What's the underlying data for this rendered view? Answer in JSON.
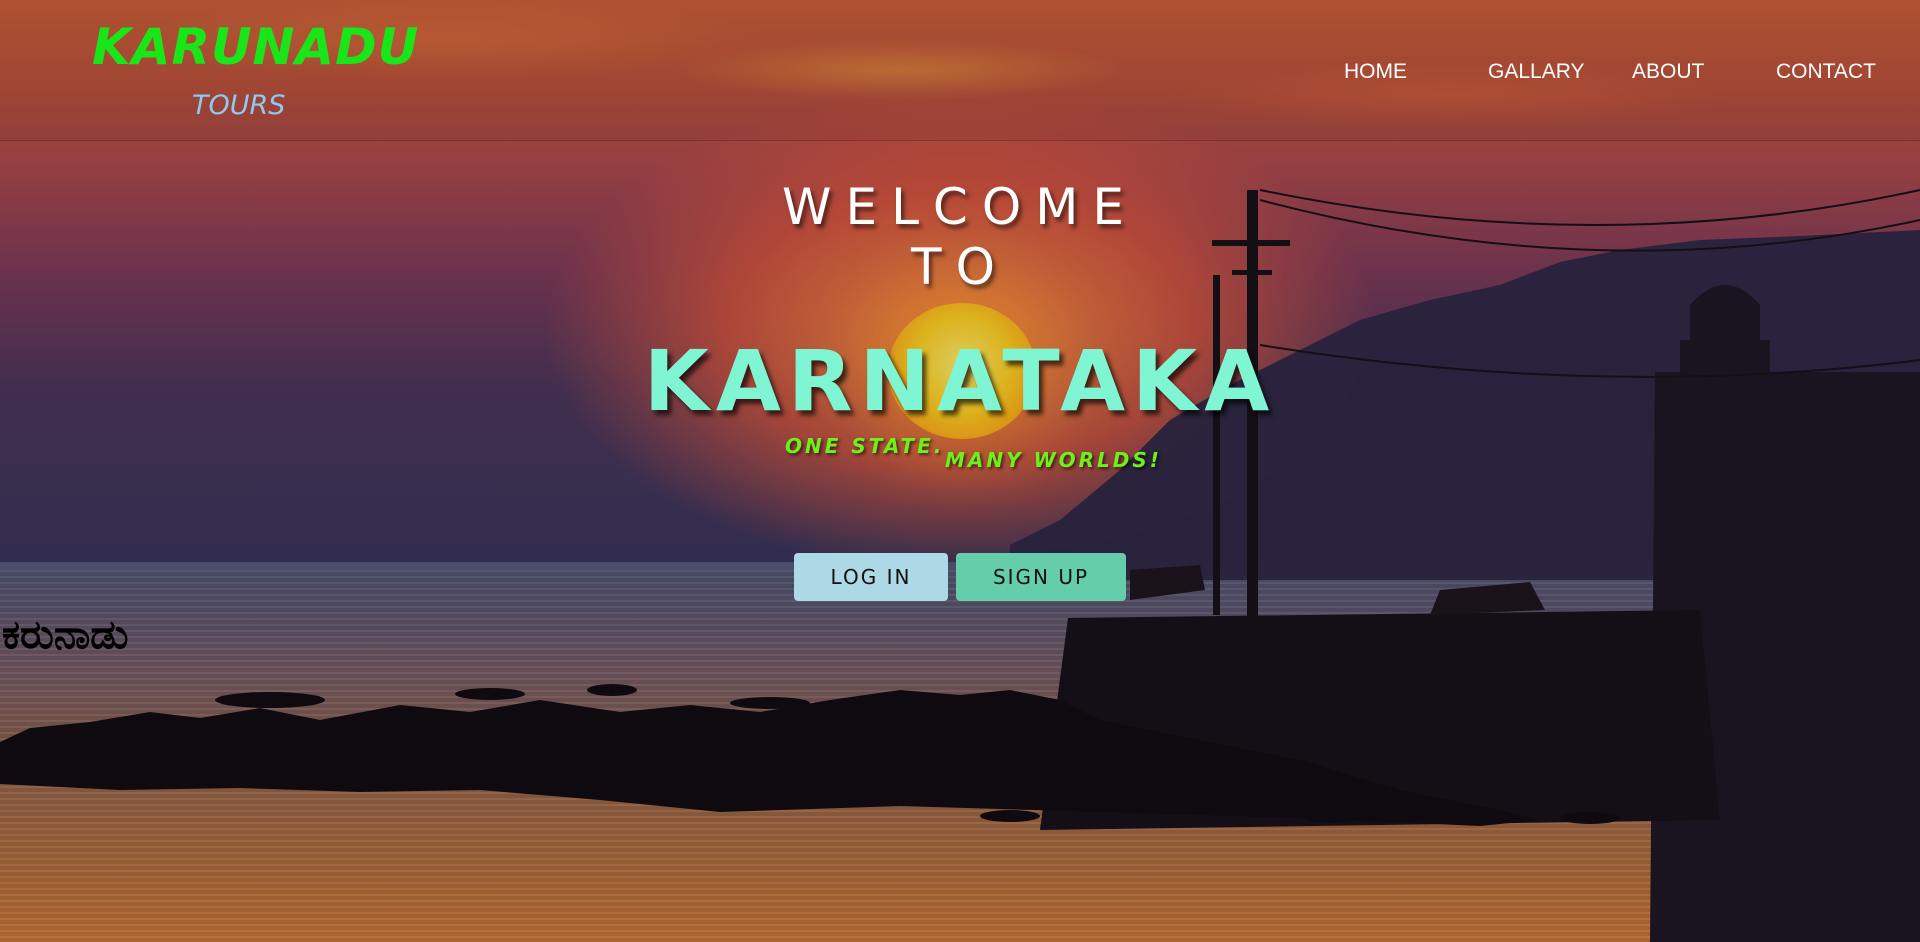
{
  "brand": {
    "title": "KARUNADU",
    "subtitle": "TOURS",
    "title_color": "#19e619",
    "subtitle_color": "#8fc8f0"
  },
  "nav": {
    "items": [
      {
        "label": "HOME"
      },
      {
        "label": "GALLARY"
      },
      {
        "label": "ABOUT"
      },
      {
        "label": "CONTACT"
      }
    ]
  },
  "hero": {
    "welcome_line1": "WELCOME",
    "welcome_line2": "TO",
    "headline": "KARNATAKA",
    "headline_color": "#7ff5d4",
    "tagline_part1": "ONE STATE.",
    "tagline_part2": "MANY WORLDS!",
    "tagline_color": "#6ef01a"
  },
  "actions": {
    "login_label": "LOG IN",
    "signup_label": "SIGN UP",
    "login_color": "#add8e6",
    "signup_color": "#66cdaa"
  },
  "footer_text": {
    "kannada_name": "ಕರುನಾಡು"
  },
  "background": {
    "description_icon": "sunset-sea-image"
  }
}
